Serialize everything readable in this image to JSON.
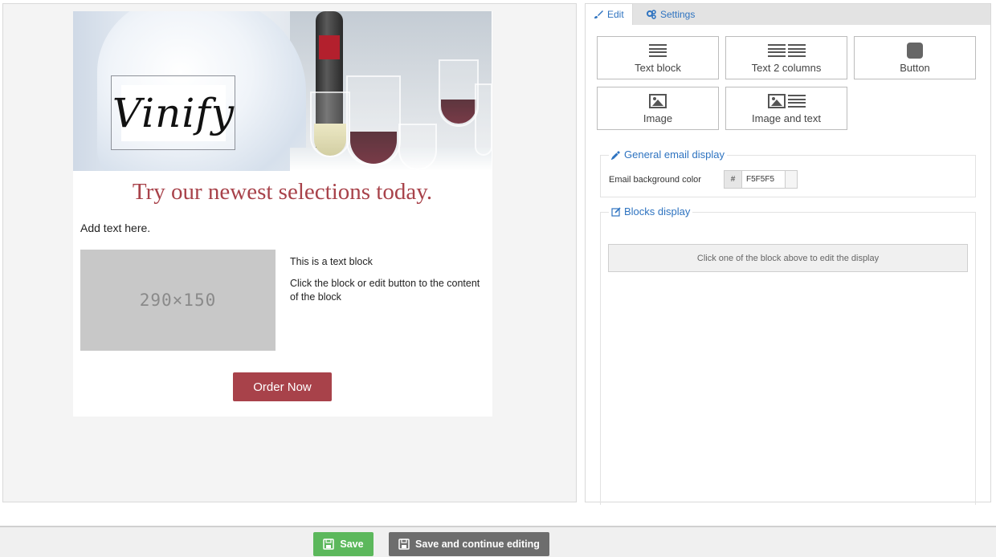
{
  "email": {
    "logo_text": "Vinify",
    "headline": "Try our newest selections today.",
    "add_text": "Add text here.",
    "image_placeholder": "290×150",
    "text_block_title": "This is a text block",
    "text_block_body": "Click the block or edit button to the content of the block",
    "order_button": "Order Now"
  },
  "panel": {
    "tabs": [
      {
        "label": "Edit",
        "icon": "brush-icon",
        "active": true
      },
      {
        "label": "Settings",
        "icon": "gears-icon",
        "active": false
      }
    ],
    "blocks": [
      {
        "label": "Text block",
        "icon": "text-lines-icon"
      },
      {
        "label": "Text 2 columns",
        "icon": "two-columns-icon"
      },
      {
        "label": "Button",
        "icon": "button-icon"
      },
      {
        "label": "Image",
        "icon": "image-icon"
      },
      {
        "label": "Image and text",
        "icon": "image-text-icon"
      }
    ],
    "general": {
      "legend": "General email display",
      "bg_label": "Email background color",
      "hash": "#",
      "bg_value": "F5F5F5"
    },
    "blocks_display": {
      "legend": "Blocks display",
      "hint": "Click one of the block above to edit the display"
    }
  },
  "footer": {
    "save": "Save",
    "save_continue": "Save and continue editing"
  },
  "colors": {
    "accent": "#a8424a",
    "link": "#2e73c0",
    "save": "#5cb85c",
    "save_continue": "#6d6d6d"
  }
}
